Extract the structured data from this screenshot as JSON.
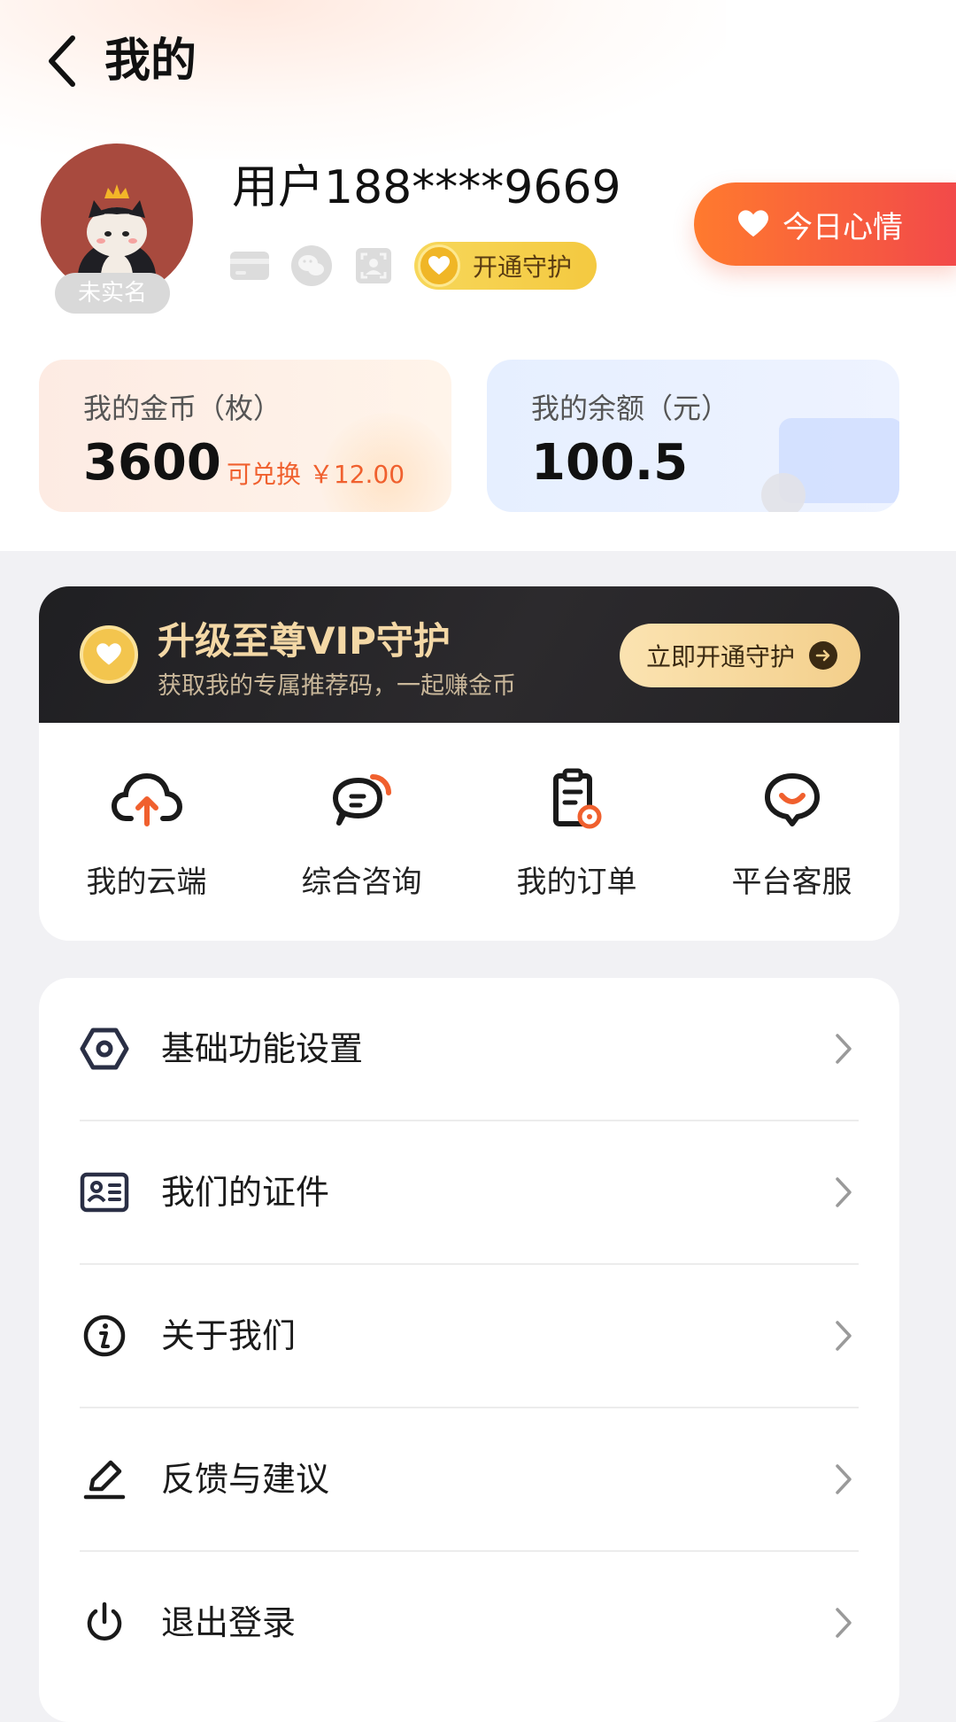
{
  "header": {
    "title": "我的"
  },
  "profile": {
    "username": "用户188****9669",
    "realname_status": "未实名",
    "guard_label": "开通守护",
    "mood_label": "今日心情"
  },
  "wallet": {
    "coins": {
      "label": "我的金币（枚）",
      "value": "3600",
      "exchange_note": "可兑换 ￥12.00"
    },
    "balance": {
      "label": "我的余额（元）",
      "value": "100.5"
    }
  },
  "vip": {
    "title": "升级至尊VIP守护",
    "subtitle": "获取我的专属推荐码，一起赚金币",
    "button_label": "立即开通守护"
  },
  "quick_actions": [
    {
      "label": "我的云端",
      "icon": "cloud-upload-icon"
    },
    {
      "label": "综合咨询",
      "icon": "chat-icon"
    },
    {
      "label": "我的订单",
      "icon": "order-icon"
    },
    {
      "label": "平台客服",
      "icon": "customer-service-icon"
    }
  ],
  "menu": [
    {
      "label": "基础功能设置",
      "icon": "settings-hexagon-icon"
    },
    {
      "label": "我们的证件",
      "icon": "id-card-icon"
    },
    {
      "label": "关于我们",
      "icon": "info-icon"
    },
    {
      "label": "反馈与建议",
      "icon": "edit-icon"
    },
    {
      "label": "退出登录",
      "icon": "power-icon"
    }
  ],
  "colors": {
    "accent_orange": "#f0602e",
    "mood_gradient_start": "#ff7a2e",
    "mood_gradient_end": "#f2494a",
    "vip_gold": "#f4d8a6"
  }
}
